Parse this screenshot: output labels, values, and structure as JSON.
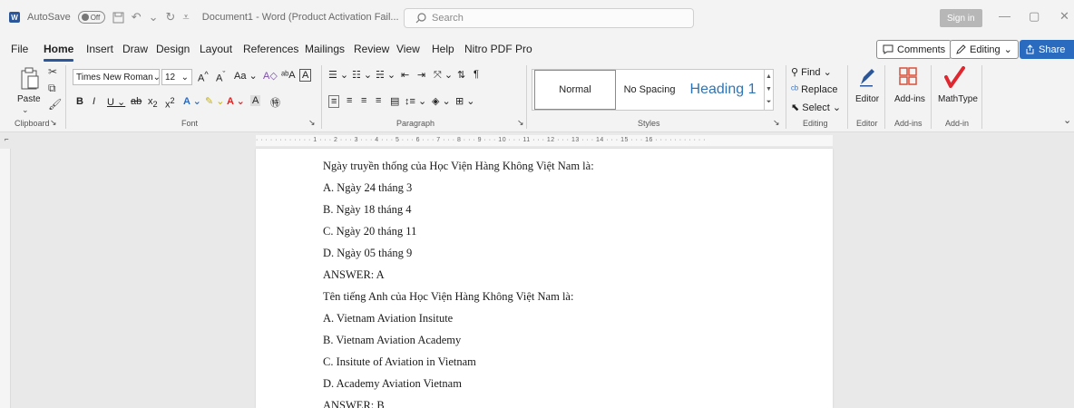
{
  "titlebar": {
    "autosave_label": "AutoSave",
    "autosave_state": "Off",
    "document_title": "Document1 - Word (Product Activation Fail...",
    "search_placeholder": "Search",
    "sign_in_label": "Sign in"
  },
  "menu": {
    "items": [
      "File",
      "Home",
      "Insert",
      "Draw",
      "Design",
      "Layout",
      "References",
      "Mailings",
      "Review",
      "View",
      "Help",
      "Nitro PDF Pro"
    ],
    "active": "Home",
    "comments_label": "Comments",
    "editing_label": "Editing",
    "share_label": "Share"
  },
  "ribbon": {
    "clipboard": {
      "paste_label": "Paste",
      "group_label": "Clipboard"
    },
    "font": {
      "font_name": "Times New Roman",
      "font_size": "12",
      "group_label": "Font"
    },
    "paragraph": {
      "group_label": "Paragraph"
    },
    "styles": {
      "normal": "Normal",
      "no_spacing": "No Spacing",
      "heading1": "Heading 1",
      "group_label": "Styles"
    },
    "editing": {
      "find": "Find",
      "replace": "Replace",
      "select": "Select",
      "group_label": "Editing"
    },
    "editor": {
      "label": "Editor",
      "group_label": "Editor"
    },
    "addins": {
      "label": "Add-ins",
      "group_label": "Add-ins"
    },
    "mathtype": {
      "label": "MathType",
      "group_label": "Add-in"
    }
  },
  "ruler": {
    "marks": "· · · · · · · · · · · · 1 · · · 2 · · · 3 · · · 4 · · · 5 · · · 6 · · · 7 · · · 8 · · · 9 · · · 10 · · · 11 · · · 12 · · · 13 · · · 14 · · · 15 · · · 16 · · · · · · · · · · ·"
  },
  "document": {
    "lines": [
      "Ngày truyền thống của Học Viện Hàng Không Việt Nam là:",
      "A. Ngày 24 tháng 3",
      "B. Ngày 18 tháng 4",
      "C. Ngày 20 tháng 11",
      "D. Ngày 05 tháng 9",
      "ANSWER: A",
      "Tên tiếng Anh của Học Viện Hàng Không Việt Nam là:",
      "A. Vietnam Aviation Insitute",
      "B. Vietnam Aviation Academy",
      "C. Insitute of Aviation in Vietnam",
      "D. Academy Aviation Vietnam",
      "ANSWER: B"
    ]
  },
  "colors": {
    "word_blue": "#2b579a",
    "share_blue": "#2b6bbf",
    "heading_blue": "#2e74b5",
    "mathtype_red": "#e0262e",
    "addins_orange": "#d8503a"
  }
}
